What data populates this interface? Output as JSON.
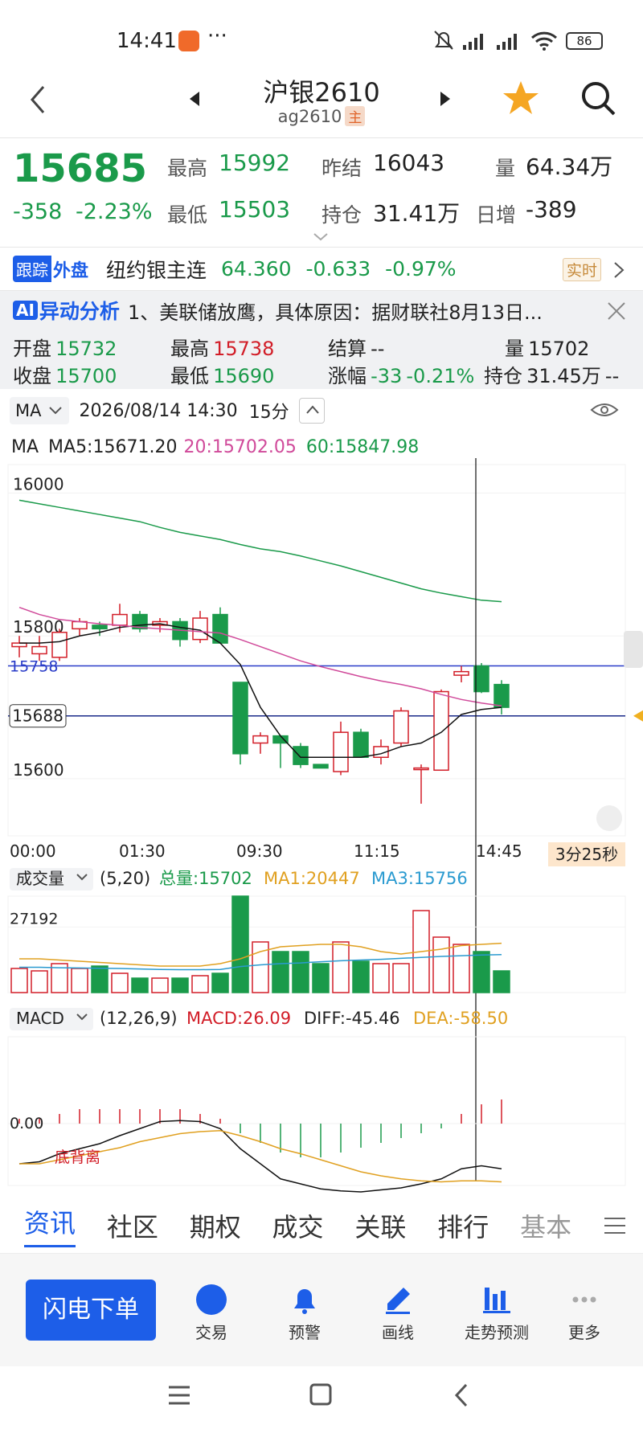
{
  "status_bar": {
    "time": "14:41",
    "dots": "···",
    "battery": "86"
  },
  "header": {
    "title": "沪银2610",
    "code": "ag2610",
    "main_badge": "主"
  },
  "quote": {
    "price": "15685",
    "change": "-358",
    "change_pct": "-2.23%",
    "high_label": "最高",
    "high": "15992",
    "low_label": "最低",
    "low": "15503",
    "prev_settle_label": "昨结",
    "prev_settle": "16043",
    "oi_label": "持仓",
    "oi": "31.41万",
    "vol_label": "量",
    "vol": "64.34万",
    "daily_inc_label": "日增",
    "daily_inc": "-389"
  },
  "external": {
    "track_badge": "跟踪",
    "outer_label": "外盘",
    "name": "纽约银主连",
    "price": "64.360",
    "change": "-0.633",
    "change_pct": "-0.97%",
    "realtime_badge": "实时"
  },
  "ai": {
    "badge": "AI",
    "title": "异动分析",
    "text": "1、美联储放鹰，具体原因：据财联社8月13日..."
  },
  "bar_info": {
    "open_label": "开盘",
    "open": "15732",
    "close_label": "收盘",
    "close": "15700",
    "high_label": "最高",
    "high": "15738",
    "low_label": "最低",
    "low": "15690",
    "settle_label": "结算",
    "settle": "--",
    "change_label": "涨幅",
    "change": "-33",
    "change_pct": "-0.21%",
    "vol_label": "量",
    "vol": "15702",
    "oi_label": "持仓",
    "oi": "31.45万",
    "oi_change": "--"
  },
  "toolbar": {
    "indicator": "MA",
    "datetime": "2026/08/14 14:30",
    "period": "15分"
  },
  "ma": {
    "label": "MA",
    "ma5": "MA5:15671.20",
    "ma20": "20:15702.05",
    "ma60": "60:15847.98"
  },
  "kline": {
    "y_labels": [
      "16000",
      "15800",
      "15600"
    ],
    "line_label_1": "15758",
    "current_label": "15688",
    "x_labels": [
      "00:00",
      "01:30",
      "09:30",
      "11:15",
      "14:45"
    ],
    "countdown": "3分25秒"
  },
  "volume": {
    "label": "成交量",
    "params": "(5,20)",
    "total": "总量:15702",
    "ma1": "MA1:20447",
    "ma3": "MA3:15756",
    "y_label": "27192"
  },
  "macd": {
    "label": "MACD",
    "params": "(12,26,9)",
    "macd": "MACD:26.09",
    "diff": "DIFF:-45.46",
    "dea": "DEA:-58.50",
    "zero": "0.00",
    "divergence": "底背离"
  },
  "tabs": [
    "资讯",
    "社区",
    "期权",
    "成交",
    "关联",
    "排行",
    "基本"
  ],
  "bottom": {
    "order_button": "闪电下单",
    "items": [
      "交易",
      "预警",
      "画线",
      "走势预测",
      "更多"
    ]
  },
  "colors": {
    "up": "#d21e28",
    "down": "#1a9a4a",
    "accent": "#1d5ee8",
    "ma20": "#d04a9a",
    "ma60": "#1a9a4a",
    "dea": "#e0a020",
    "ma3": "#2a9ad0"
  },
  "chart_data": {
    "type": "candlestick",
    "period": "15分",
    "x_ticks": [
      "00:00",
      "01:30",
      "09:30",
      "11:15",
      "14:45"
    ],
    "ohlc": [
      [
        15785,
        15800,
        15770,
        15790
      ],
      [
        15775,
        15800,
        15765,
        15785
      ],
      [
        15770,
        15810,
        15765,
        15805
      ],
      [
        15810,
        15825,
        15800,
        15820
      ],
      [
        15815,
        15820,
        15800,
        15810
      ],
      [
        15815,
        15845,
        15805,
        15830
      ],
      [
        15830,
        15835,
        15805,
        15810
      ],
      [
        15815,
        15825,
        15805,
        15820
      ],
      [
        15820,
        15825,
        15785,
        15795
      ],
      [
        15795,
        15835,
        15790,
        15825
      ],
      [
        15830,
        15840,
        15790,
        15790
      ],
      [
        15735,
        15735,
        15620,
        15635
      ],
      [
        15650,
        15665,
        15635,
        15660
      ],
      [
        15660,
        15660,
        15615,
        15650
      ],
      [
        15645,
        15650,
        15615,
        15620
      ],
      [
        15620,
        15620,
        15615,
        15615
      ],
      [
        15610,
        15680,
        15605,
        15665
      ],
      [
        15665,
        15670,
        15630,
        15630
      ],
      [
        15630,
        15655,
        15620,
        15645
      ],
      [
        15650,
        15700,
        15645,
        15695
      ],
      [
        15615,
        15620,
        15565,
        15615
      ],
      [
        15612,
        15725,
        15612,
        15722
      ],
      [
        15745,
        15758,
        15735,
        15750
      ],
      [
        15758,
        15762,
        15720,
        15722
      ],
      [
        15732,
        15738,
        15690,
        15700
      ]
    ],
    "ma5": [
      15790,
      15790,
      15792,
      15800,
      15805,
      15812,
      15815,
      15817,
      15812,
      15808,
      15790,
      15760,
      15700,
      15660,
      15630,
      15630,
      15630,
      15630,
      15635,
      15645,
      15650,
      15665,
      15690,
      15697,
      15700
    ],
    "ma20": [
      15840,
      15830,
      15823,
      15820,
      15817,
      15815,
      15812,
      15810,
      15808,
      15806,
      15804,
      15795,
      15785,
      15775,
      15765,
      15757,
      15750,
      15743,
      15737,
      15732,
      15726,
      15718,
      15711,
      15706,
      15702
    ],
    "ma60": [
      15990,
      15985,
      15980,
      15975,
      15970,
      15965,
      15960,
      15952,
      15945,
      15940,
      15935,
      15928,
      15922,
      15918,
      15912,
      15905,
      15898,
      15890,
      15882,
      15874,
      15866,
      15860,
      15855,
      15850,
      15848
    ],
    "volume": [
      10000,
      9000,
      12000,
      10000,
      11000,
      8000,
      6000,
      6000,
      6000,
      7000,
      8000,
      40000,
      21000,
      17000,
      17000,
      12000,
      21000,
      13000,
      12000,
      12000,
      34000,
      23000,
      20000,
      17000,
      9000
    ],
    "vol_ma1": [
      14000,
      14000,
      13500,
      13000,
      12500,
      12000,
      11500,
      11000,
      11000,
      11000,
      12000,
      14000,
      17000,
      19000,
      19500,
      20000,
      20000,
      19000,
      17000,
      16000,
      17000,
      18000,
      19500,
      20000,
      20447
    ],
    "vol_ma3": [
      10500,
      10500,
      10300,
      10200,
      10100,
      10000,
      9800,
      9600,
      9500,
      9500,
      9600,
      10800,
      11500,
      12000,
      12300,
      12800,
      13200,
      13500,
      13800,
      14200,
      14600,
      15000,
      15300,
      15600,
      15756
    ],
    "macd_hist": [
      1,
      1,
      2,
      3,
      3,
      3,
      3,
      3,
      3,
      2,
      1,
      -2,
      -4,
      -6,
      -7,
      -7,
      -6,
      -5,
      -4,
      -3,
      -2,
      -1,
      2,
      4,
      5
    ],
    "macd_diff": [
      -40,
      -38,
      -30,
      -25,
      -20,
      -12,
      -5,
      2,
      3,
      2,
      -5,
      -25,
      -40,
      -55,
      -60,
      -65,
      -67,
      -68,
      -66,
      -64,
      -60,
      -55,
      -45,
      -42,
      -45
    ],
    "macd_dea": [
      -40,
      -40,
      -36,
      -32,
      -28,
      -24,
      -18,
      -14,
      -10,
      -8,
      -7,
      -12,
      -18,
      -25,
      -30,
      -36,
      -42,
      -48,
      -52,
      -55,
      -57,
      -58,
      -57,
      -57,
      -58
    ]
  }
}
